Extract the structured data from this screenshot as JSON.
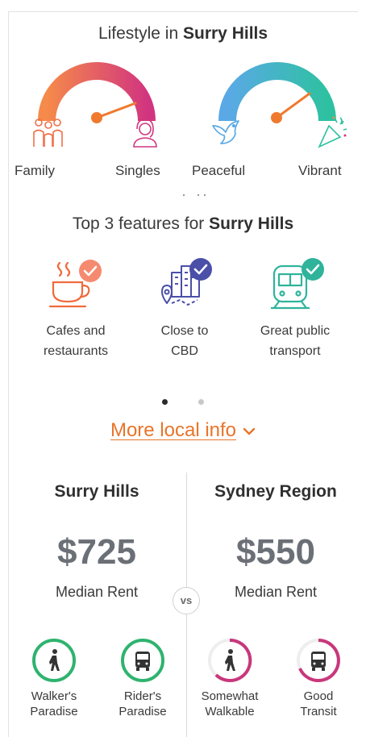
{
  "lifestyle": {
    "title_prefix": "Lifestyle in ",
    "title_suburb": "Surry Hills",
    "gauges": [
      {
        "left_label": "Family",
        "right_label": "Singles",
        "left_icon": "family-icon",
        "right_icon": "single-person-icon",
        "gradient": [
          "#f58a4a",
          "#d2357f"
        ],
        "level": 0.8
      },
      {
        "left_label": "Peaceful",
        "right_label": "Vibrant",
        "left_icon": "dove-icon",
        "right_icon": "party-popper-icon",
        "gradient": [
          "#5aa9e6",
          "#2ec1a1"
        ],
        "level": 0.75
      }
    ],
    "needle_color": "#ef7a2e"
  },
  "features": {
    "title_prefix": "Top 3 features for ",
    "title_suburb": "Surry Hills",
    "items": [
      {
        "line1": "Cafes and",
        "line2": "restaurants",
        "icon": "coffee-cup-icon",
        "color": "#f06a3a"
      },
      {
        "line1": "Close to",
        "line2": "CBD",
        "icon": "city-map-icon",
        "color": "#4a4fa8"
      },
      {
        "line1": "Great public",
        "line2": "transport",
        "icon": "train-icon",
        "color": "#2fb39b"
      }
    ],
    "pager": {
      "active": 0,
      "total": 2
    }
  },
  "more_link": {
    "label": "More local info"
  },
  "compare": {
    "vs": "vs",
    "left": {
      "name": "Surry Hills",
      "price": "$725",
      "price_label": "Median Rent"
    },
    "right": {
      "name": "Sydney Region",
      "price": "$550",
      "price_label": "Median Rent"
    },
    "scores": [
      {
        "line1": "Walker's",
        "line2": "Paradise",
        "icon": "walker-icon",
        "color": "#2fb36e",
        "level": 1.0
      },
      {
        "line1": "Rider's",
        "line2": "Paradise",
        "icon": "bus-icon",
        "color": "#2fb36e",
        "level": 1.0
      },
      {
        "line1": "Somewhat",
        "line2": "Walkable",
        "icon": "walker-icon",
        "color": "#c8377b",
        "level": 0.55
      },
      {
        "line1": "Good",
        "line2": "Transit",
        "icon": "bus-icon",
        "color": "#c8377b",
        "level": 0.65
      }
    ]
  }
}
